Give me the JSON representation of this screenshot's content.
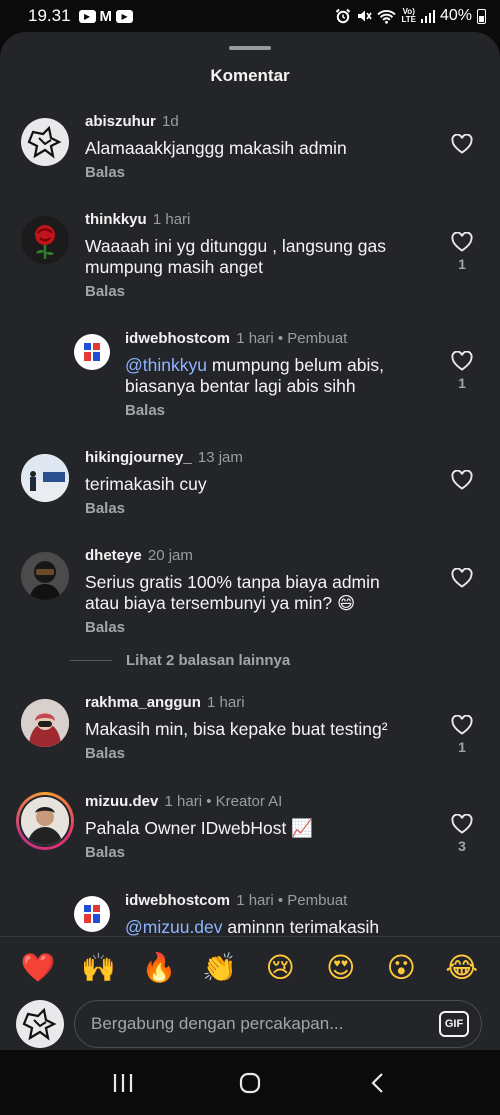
{
  "status_bar": {
    "time": "19.31",
    "app_badges": [
      "▶",
      "M",
      "▶"
    ],
    "battery": "40%",
    "volte_top": "Vo)",
    "volte_bottom": "LTE",
    "icons": [
      "youtube-icon",
      "gmail-icon",
      "youtube-icon",
      "alarm-icon",
      "mute-icon",
      "wifi-icon",
      "volte-icon",
      "signal-icon",
      "battery-icon"
    ]
  },
  "sheet": {
    "title": "Komentar"
  },
  "comments": [
    {
      "user": "abiszuhur",
      "meta": "1d",
      "text": "Alamaaakkjanggg makasih admin",
      "reply_label": "Balas",
      "likes": ""
    },
    {
      "user": "thinkkyu",
      "meta": "1 hari",
      "text": "Waaaah ini yg ditunggu , langsung gas mumpung masih anget",
      "reply_label": "Balas",
      "likes": "1"
    },
    {
      "user": "idwebhostcom",
      "meta": "1 hari • Pembuat",
      "mention": "@thinkkyu",
      "text": " mumpung belum abis, biasanya bentar lagi abis sihh",
      "reply_label": "Balas",
      "likes": "1"
    },
    {
      "user": "hikingjourney_",
      "meta": "13 jam",
      "text": "terimakasih cuy",
      "reply_label": "Balas",
      "likes": ""
    },
    {
      "user": "dheteye",
      "meta": "20 jam",
      "text": "Serius gratis 100% tanpa biaya admin atau biaya tersembunyi ya min? 😄",
      "reply_label": "Balas",
      "likes": ""
    },
    {
      "user": "rakhma_anggun",
      "meta": "1 hari",
      "text": "Makasih min, bisa kepake buat testing²",
      "reply_label": "Balas",
      "likes": "1"
    },
    {
      "user": "mizuu.dev",
      "meta": "1 hari • Kreator AI",
      "text": "Pahala Owner IDwebHost 📈",
      "reply_label": "Balas",
      "likes": "3"
    },
    {
      "user": "idwebhostcom",
      "meta": "1 hari • Pembuat",
      "mention": "@mizuu.dev",
      "text": " aminnn terimakasih",
      "reply_label": "",
      "likes": ""
    }
  ],
  "more_replies": "Lihat 2 balasan lainnya",
  "emoji_bar": [
    "❤️",
    "🙌",
    "🔥",
    "👏",
    "😢",
    "😍",
    "😮",
    "😂"
  ],
  "input": {
    "placeholder": "Bergabung dengan percakapan...",
    "gif_label": "GIF"
  },
  "nav": {
    "icons": [
      "recent-apps-icon",
      "home-icon",
      "back-icon"
    ]
  },
  "colors": {
    "background": "#0b0b0b",
    "sheet": "#232529",
    "mention": "#8db5ff",
    "muted": "#9a9ca2",
    "story_ring": "#c13584"
  }
}
